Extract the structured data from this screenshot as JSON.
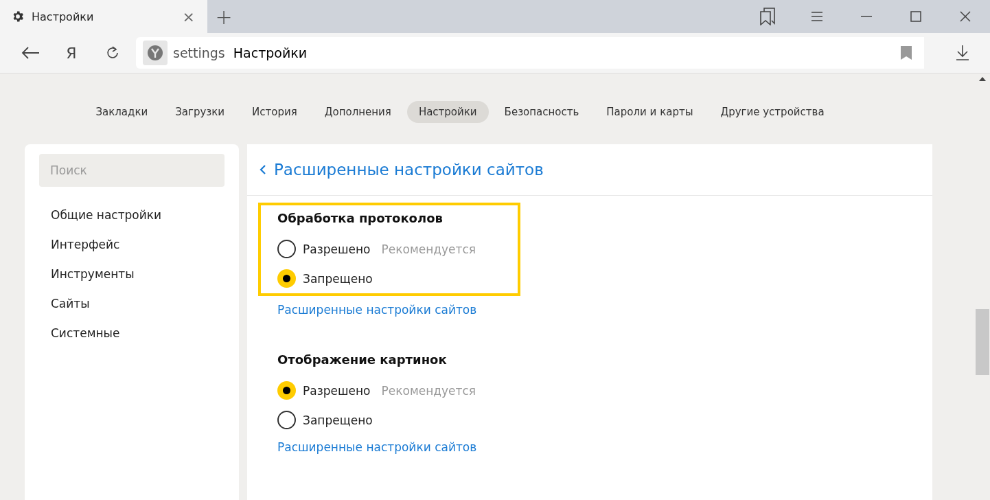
{
  "window": {
    "tab": {
      "title": "Настройки",
      "close": "×"
    },
    "new_tab": "+"
  },
  "toolbar": {
    "yandex_button": "Я",
    "address": {
      "host": "settings",
      "title": "Настройки"
    }
  },
  "nav": [
    {
      "label": "Закладки",
      "selected": false
    },
    {
      "label": "Загрузки",
      "selected": false
    },
    {
      "label": "История",
      "selected": false
    },
    {
      "label": "Дополнения",
      "selected": false
    },
    {
      "label": "Настройки",
      "selected": true
    },
    {
      "label": "Безопасность",
      "selected": false
    },
    {
      "label": "Пароли и карты",
      "selected": false
    },
    {
      "label": "Другие устройства",
      "selected": false
    }
  ],
  "sidebar": {
    "search": {
      "placeholder": "Поиск"
    },
    "items": [
      "Общие настройки",
      "Интерфейс",
      "Инструменты",
      "Сайты",
      "Системные"
    ]
  },
  "page": {
    "title": "Расширенные настройки сайтов"
  },
  "sections": [
    {
      "title": "Обработка протоколов",
      "highlighted": true,
      "options": [
        {
          "label": "Разрешено",
          "hint": "Рекомендуется",
          "selected": false
        },
        {
          "label": "Запрещено",
          "selected": true
        }
      ],
      "link": "Расширенные настройки сайтов"
    },
    {
      "title": "Отображение картинок",
      "highlighted": false,
      "options": [
        {
          "label": "Разрешено",
          "hint": "Рекомендуется",
          "selected": true
        },
        {
          "label": "Запрещено",
          "selected": false
        }
      ],
      "link": "Расширенные настройки сайтов"
    }
  ]
}
